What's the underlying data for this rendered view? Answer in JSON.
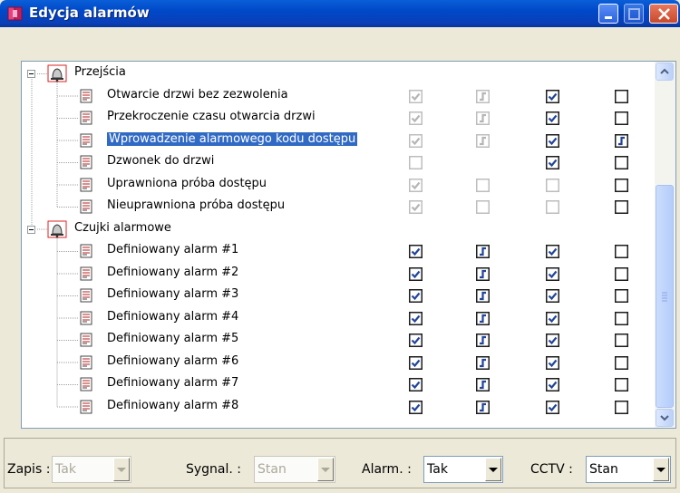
{
  "window": {
    "title": "Edycja alarmów"
  },
  "tree": {
    "groups": [
      {
        "label": "Przejścia",
        "items": [
          {
            "label": "Otwarcie drzwi bez zezwolenia",
            "checks": [
              "checked-disabled",
              "toggle-disabled",
              "checked",
              "unchecked"
            ]
          },
          {
            "label": "Przekroczenie czasu otwarcia drzwi",
            "checks": [
              "checked-disabled",
              "toggle-disabled",
              "checked",
              "unchecked"
            ]
          },
          {
            "label": "Wprowadzenie alarmowego kodu dostępu",
            "selected": true,
            "checks": [
              "checked-disabled",
              "toggle-disabled",
              "checked",
              "toggle"
            ]
          },
          {
            "label": "Dzwonek do drzwi",
            "checks": [
              "unchecked-disabled",
              "none",
              "checked",
              "unchecked"
            ]
          },
          {
            "label": "Uprawniona próba dostępu",
            "checks": [
              "checked-disabled",
              "unchecked-disabled",
              "unchecked-disabled",
              "unchecked"
            ]
          },
          {
            "label": "Nieuprawniona próba dostępu",
            "checks": [
              "checked-disabled",
              "unchecked-disabled",
              "unchecked-disabled",
              "unchecked"
            ]
          }
        ]
      },
      {
        "label": "Czujki alarmowe",
        "items": [
          {
            "label": "Definiowany alarm #1",
            "checks": [
              "checked",
              "toggle",
              "checked",
              "unchecked"
            ]
          },
          {
            "label": "Definiowany alarm #2",
            "checks": [
              "checked",
              "toggle",
              "checked",
              "unchecked"
            ]
          },
          {
            "label": "Definiowany alarm #3",
            "checks": [
              "checked",
              "toggle",
              "checked",
              "unchecked"
            ]
          },
          {
            "label": "Definiowany alarm #4",
            "checks": [
              "checked",
              "toggle",
              "checked",
              "unchecked"
            ]
          },
          {
            "label": "Definiowany alarm #5",
            "checks": [
              "checked",
              "toggle",
              "checked",
              "unchecked"
            ]
          },
          {
            "label": "Definiowany alarm #6",
            "checks": [
              "checked",
              "toggle",
              "checked",
              "unchecked"
            ]
          },
          {
            "label": "Definiowany alarm #7",
            "checks": [
              "checked",
              "toggle",
              "checked",
              "unchecked"
            ]
          },
          {
            "label": "Definiowany alarm #8",
            "checks": [
              "checked",
              "toggle",
              "checked",
              "unchecked"
            ]
          }
        ]
      }
    ]
  },
  "fields": {
    "zapis": {
      "label": "Zapis :",
      "value": "Tak",
      "disabled": true
    },
    "sygnal": {
      "label": "Sygnal. :",
      "value": "Stan",
      "disabled": true
    },
    "alarm": {
      "label": "Alarm. :",
      "value": "Tak",
      "disabled": false
    },
    "cctv": {
      "label": "CCTV :",
      "value": "Stan",
      "disabled": false
    }
  },
  "colors": {
    "titlebar": "#0a5fd8",
    "selection": "#316ac5",
    "check_blue": "#21449c",
    "panel": "#ece9d8"
  }
}
